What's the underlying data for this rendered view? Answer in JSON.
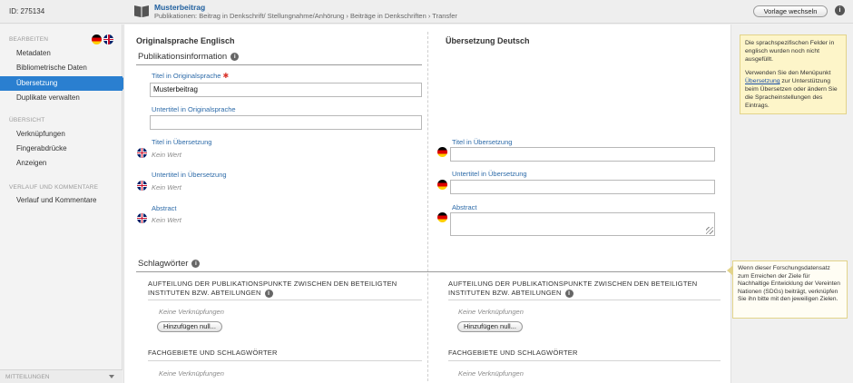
{
  "topbar": {
    "record_id": "ID: 275134",
    "doc_icon": "book-icon",
    "title": "Musterbeitrag",
    "path": "Publikationen: Beitrag in Denkschrift/ Stellungnahme/Anhörung › Beiträge in Denkschriften › Transfer",
    "template_button": "Vorlage wechseln",
    "info_icon": "i"
  },
  "sidebar": {
    "sections": [
      {
        "heading": "BEARBEITEN",
        "items": [
          "Metadaten",
          "Bibliometrische Daten",
          "Übersetzung",
          "Duplikate verwalten"
        ],
        "active": "Übersetzung"
      },
      {
        "heading": "ÜBERSICHT",
        "items": [
          "Verknüpfungen",
          "Fingerabdrücke",
          "Anzeigen"
        ]
      },
      {
        "heading": "VERLAUF UND KOMMENTARE",
        "items": [
          "Verlauf und Kommentare"
        ]
      }
    ],
    "flags": [
      "de-flag-icon",
      "uk-flag-icon"
    ],
    "messages_label": "MITTEILUNGEN"
  },
  "main": {
    "left_column_title": "Originalsprache Englisch",
    "right_column_title": "Übersetzung Deutsch",
    "pubinfo": {
      "title": "Publikationsinformation",
      "info_icon": "i",
      "title_original_label": "Titel in Originalsprache",
      "required_mark": "✱",
      "title_original_value": "Musterbeitrag",
      "subtitle_original_label": "Untertitel in Originalsprache",
      "subtitle_original_value": "",
      "title_translation_label": "Titel in Übersetzung",
      "subtitle_translation_label": "Untertitel in Übersetzung",
      "abstract_label": "Abstract",
      "no_value": "Kein Wert"
    },
    "keywords": {
      "title": "Schlagwörter",
      "info_icon": "i",
      "allocation_heading_line1": "AUFTEILUNG DER PUBLIKATIONSPUNKTE ZWISCHEN DEN BETEILIGTEN",
      "allocation_heading_line2": "INSTITUTEN BZW. ABTEILUNGEN",
      "no_links": "Keine Verknüpfungen",
      "add_button": "Hinzufügen null...",
      "fields_heading": "FACHGEBIETE UND SCHLAGWÖRTER"
    }
  },
  "help": {
    "yellow_p1": "Die sprachspezifischen Felder in englisch wurden noch nicht ausgefüllt.",
    "yellow_p2_before": "Verwenden Sie den Menüpunkt ",
    "yellow_p2_link": "Übersetzung",
    "yellow_p2_after": " zur Unterstützung beim Übersetzen oder ändern Sie die Spracheinstellungen des Eintrags.",
    "white_note": "Wenn dieser Forschungsdatensatz zum Erreichen der Ziele für Nachhaltige Entwicklung der Vereinten Nationen (SDGs) beiträgt, verknüpfen Sie ihn bitte mit den jeweiligen Zielen."
  }
}
